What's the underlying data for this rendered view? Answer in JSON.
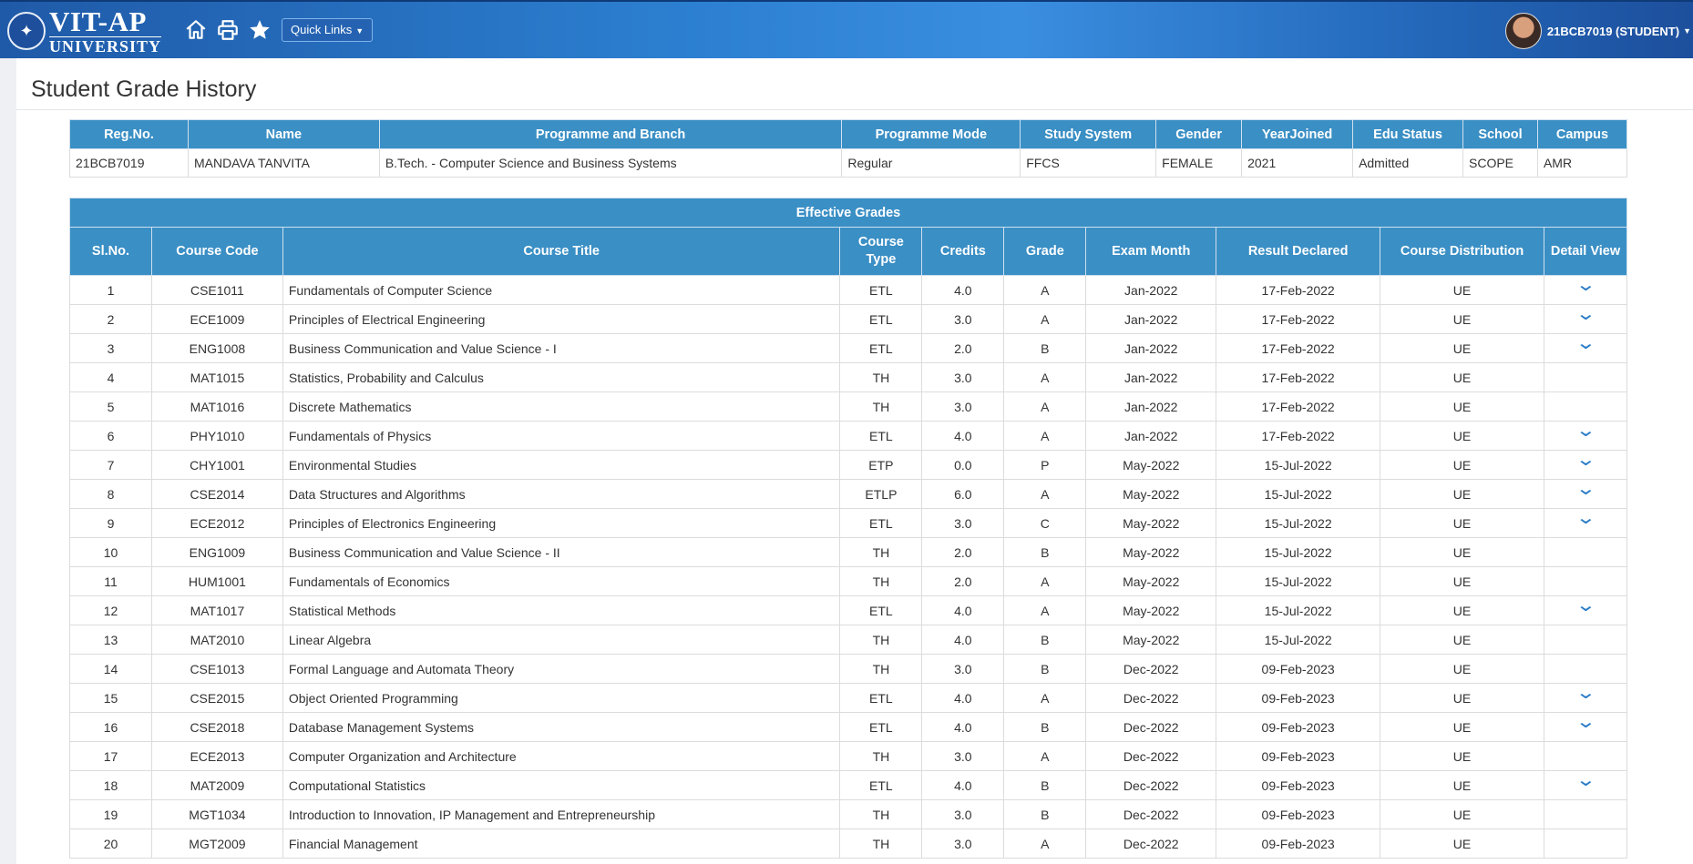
{
  "header": {
    "logo_line1": "VIT-AP",
    "logo_line2": "UNIVERSITY",
    "quick_links_label": "Quick Links",
    "user_label": "21BCB7019 (STUDENT)",
    "icons": [
      "home-icon",
      "print-icon",
      "star-icon"
    ]
  },
  "page": {
    "title": "Student Grade History"
  },
  "student_info": {
    "headers": [
      "Reg.No.",
      "Name",
      "Programme and Branch",
      "Programme Mode",
      "Study System",
      "Gender",
      "YearJoined",
      "Edu Status",
      "School",
      "Campus"
    ],
    "values": [
      "21BCB7019",
      "MANDAVA TANVITA",
      "B.Tech. - Computer Science and Business Systems",
      "Regular",
      "FFCS",
      "FEMALE",
      "2021",
      "Admitted",
      "SCOPE",
      "AMR"
    ]
  },
  "grades": {
    "caption": "Effective Grades",
    "headers": [
      "Sl.No.",
      "Course Code",
      "Course Title",
      "Course Type",
      "Credits",
      "Grade",
      "Exam Month",
      "Result Declared",
      "Course Distribution",
      "Detail View"
    ],
    "rows": [
      {
        "sl": "1",
        "code": "CSE1011",
        "title": "Fundamentals of Computer Science",
        "type": "ETL",
        "credits": "4.0",
        "grade": "A",
        "exam": "Jan-2022",
        "result": "17-Feb-2022",
        "dist": "UE",
        "detail": true
      },
      {
        "sl": "2",
        "code": "ECE1009",
        "title": "Principles of Electrical Engineering",
        "type": "ETL",
        "credits": "3.0",
        "grade": "A",
        "exam": "Jan-2022",
        "result": "17-Feb-2022",
        "dist": "UE",
        "detail": true
      },
      {
        "sl": "3",
        "code": "ENG1008",
        "title": "Business Communication and Value Science - I",
        "type": "ETL",
        "credits": "2.0",
        "grade": "B",
        "exam": "Jan-2022",
        "result": "17-Feb-2022",
        "dist": "UE",
        "detail": true
      },
      {
        "sl": "4",
        "code": "MAT1015",
        "title": "Statistics, Probability and Calculus",
        "type": "TH",
        "credits": "3.0",
        "grade": "A",
        "exam": "Jan-2022",
        "result": "17-Feb-2022",
        "dist": "UE",
        "detail": false
      },
      {
        "sl": "5",
        "code": "MAT1016",
        "title": "Discrete Mathematics",
        "type": "TH",
        "credits": "3.0",
        "grade": "A",
        "exam": "Jan-2022",
        "result": "17-Feb-2022",
        "dist": "UE",
        "detail": false
      },
      {
        "sl": "6",
        "code": "PHY1010",
        "title": "Fundamentals of Physics",
        "type": "ETL",
        "credits": "4.0",
        "grade": "A",
        "exam": "Jan-2022",
        "result": "17-Feb-2022",
        "dist": "UE",
        "detail": true
      },
      {
        "sl": "7",
        "code": "CHY1001",
        "title": "Environmental Studies",
        "type": "ETP",
        "credits": "0.0",
        "grade": "P",
        "exam": "May-2022",
        "result": "15-Jul-2022",
        "dist": "UE",
        "detail": true
      },
      {
        "sl": "8",
        "code": "CSE2014",
        "title": "Data Structures and Algorithms",
        "type": "ETLP",
        "credits": "6.0",
        "grade": "A",
        "exam": "May-2022",
        "result": "15-Jul-2022",
        "dist": "UE",
        "detail": true
      },
      {
        "sl": "9",
        "code": "ECE2012",
        "title": "Principles of Electronics Engineering",
        "type": "ETL",
        "credits": "3.0",
        "grade": "C",
        "exam": "May-2022",
        "result": "15-Jul-2022",
        "dist": "UE",
        "detail": true
      },
      {
        "sl": "10",
        "code": "ENG1009",
        "title": "Business Communication and Value Science - II",
        "type": "TH",
        "credits": "2.0",
        "grade": "B",
        "exam": "May-2022",
        "result": "15-Jul-2022",
        "dist": "UE",
        "detail": false
      },
      {
        "sl": "11",
        "code": "HUM1001",
        "title": "Fundamentals of Economics",
        "type": "TH",
        "credits": "2.0",
        "grade": "A",
        "exam": "May-2022",
        "result": "15-Jul-2022",
        "dist": "UE",
        "detail": false
      },
      {
        "sl": "12",
        "code": "MAT1017",
        "title": "Statistical Methods",
        "type": "ETL",
        "credits": "4.0",
        "grade": "A",
        "exam": "May-2022",
        "result": "15-Jul-2022",
        "dist": "UE",
        "detail": true
      },
      {
        "sl": "13",
        "code": "MAT2010",
        "title": "Linear Algebra",
        "type": "TH",
        "credits": "4.0",
        "grade": "B",
        "exam": "May-2022",
        "result": "15-Jul-2022",
        "dist": "UE",
        "detail": false
      },
      {
        "sl": "14",
        "code": "CSE1013",
        "title": "Formal Language and Automata Theory",
        "type": "TH",
        "credits": "3.0",
        "grade": "B",
        "exam": "Dec-2022",
        "result": "09-Feb-2023",
        "dist": "UE",
        "detail": false
      },
      {
        "sl": "15",
        "code": "CSE2015",
        "title": "Object Oriented Programming",
        "type": "ETL",
        "credits": "4.0",
        "grade": "A",
        "exam": "Dec-2022",
        "result": "09-Feb-2023",
        "dist": "UE",
        "detail": true
      },
      {
        "sl": "16",
        "code": "CSE2018",
        "title": "Database Management Systems",
        "type": "ETL",
        "credits": "4.0",
        "grade": "B",
        "exam": "Dec-2022",
        "result": "09-Feb-2023",
        "dist": "UE",
        "detail": true
      },
      {
        "sl": "17",
        "code": "ECE2013",
        "title": "Computer Organization and Architecture",
        "type": "TH",
        "credits": "3.0",
        "grade": "A",
        "exam": "Dec-2022",
        "result": "09-Feb-2023",
        "dist": "UE",
        "detail": false
      },
      {
        "sl": "18",
        "code": "MAT2009",
        "title": "Computational Statistics",
        "type": "ETL",
        "credits": "4.0",
        "grade": "B",
        "exam": "Dec-2022",
        "result": "09-Feb-2023",
        "dist": "UE",
        "detail": true
      },
      {
        "sl": "19",
        "code": "MGT1034",
        "title": "Introduction to Innovation, IP Management and Entrepreneurship",
        "type": "TH",
        "credits": "3.0",
        "grade": "B",
        "exam": "Dec-2022",
        "result": "09-Feb-2023",
        "dist": "UE",
        "detail": false
      },
      {
        "sl": "20",
        "code": "MGT2009",
        "title": "Financial Management",
        "type": "TH",
        "credits": "3.0",
        "grade": "A",
        "exam": "Dec-2022",
        "result": "09-Feb-2023",
        "dist": "UE",
        "detail": false
      }
    ]
  },
  "colors": {
    "header_blue": "#3a8fc5",
    "topbar_blue": "#2c7fd0",
    "chevron_blue": "#2a7cc7"
  }
}
